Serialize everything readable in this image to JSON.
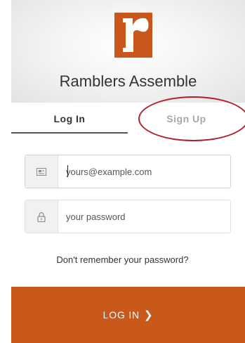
{
  "app": {
    "title": "Ramblers Assemble",
    "logo_letter": "r",
    "brand_color": "#c9581b"
  },
  "tabs": [
    {
      "label": "Log In",
      "active": true
    },
    {
      "label": "Sign Up",
      "active": false
    }
  ],
  "form": {
    "email": {
      "placeholder": "yours@example.com",
      "value": "",
      "icon": "envelope-icon"
    },
    "password": {
      "placeholder": "your password",
      "value": "",
      "icon": "lock-icon"
    },
    "forgot_label": "Don't remember your password?",
    "submit_label": "LOG IN",
    "submit_icon": "chevron-right-icon"
  },
  "annotation": {
    "type": "ellipse",
    "target": "Sign Up",
    "color": "#b0202a"
  }
}
